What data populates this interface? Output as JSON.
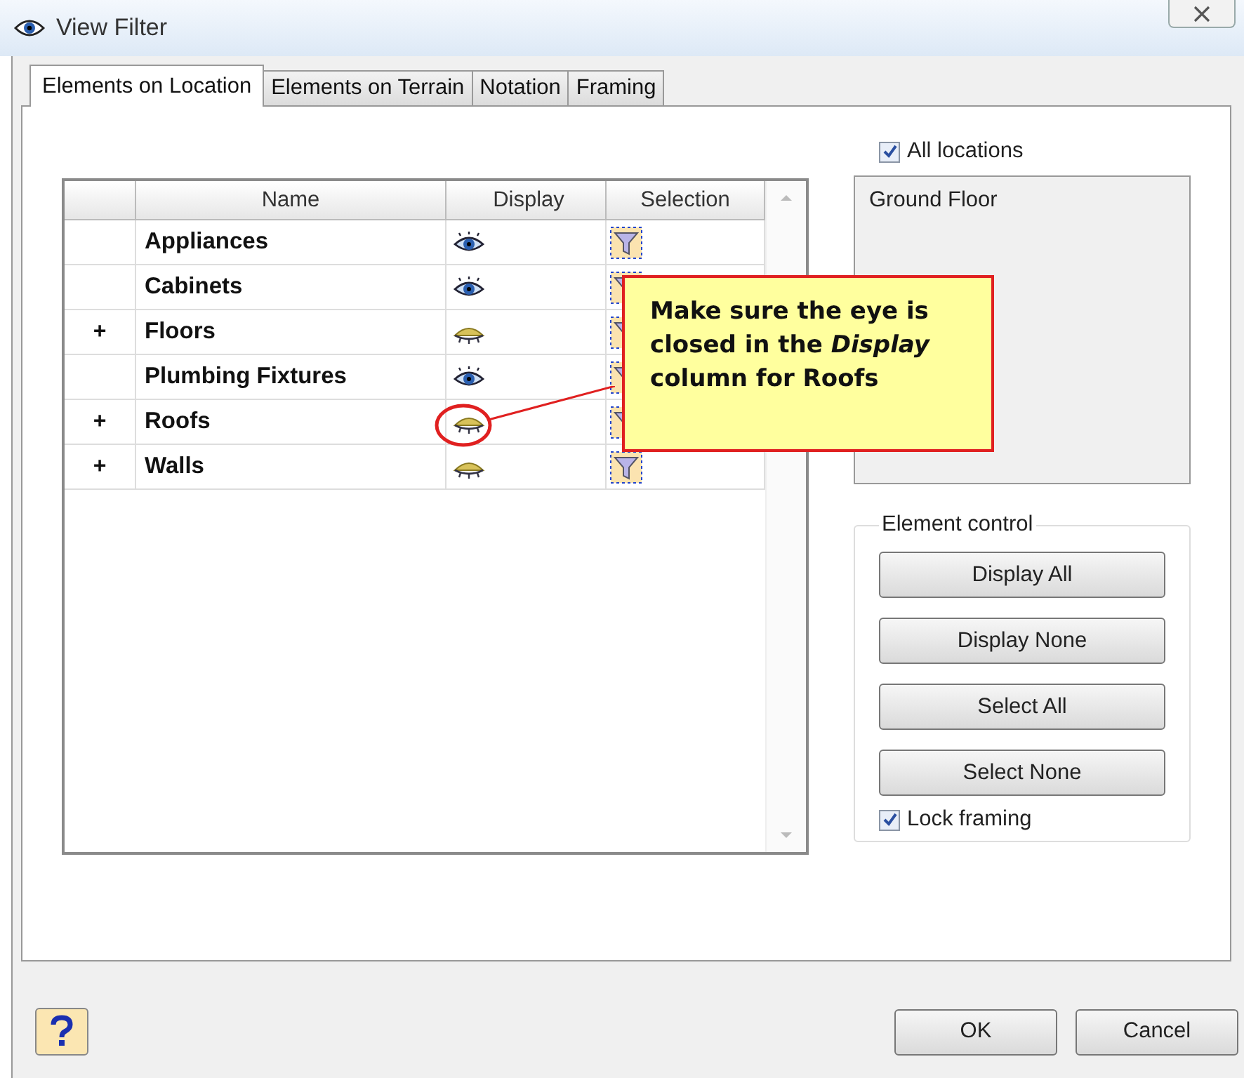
{
  "window": {
    "title": "View Filter"
  },
  "tabs": [
    {
      "label": "Elements on Location",
      "selected": true
    },
    {
      "label": "Elements on Terrain",
      "selected": false
    },
    {
      "label": "Notation",
      "selected": false
    },
    {
      "label": "Framing",
      "selected": false
    }
  ],
  "table": {
    "columns": [
      "Name",
      "Display",
      "Selection"
    ],
    "rows": [
      {
        "expander": "",
        "name": "Appliances",
        "displayed": true,
        "highlighted": false
      },
      {
        "expander": "",
        "name": "Cabinets",
        "displayed": true,
        "highlighted": false
      },
      {
        "expander": "+",
        "name": "Floors",
        "displayed": false,
        "highlighted": false
      },
      {
        "expander": "",
        "name": "Plumbing Fixtures",
        "displayed": true,
        "highlighted": false
      },
      {
        "expander": "+",
        "name": "Roofs",
        "displayed": false,
        "highlighted": true
      },
      {
        "expander": "+",
        "name": "Walls",
        "displayed": false,
        "highlighted": false
      }
    ]
  },
  "locations": {
    "all_label": "All locations",
    "all_checked": true,
    "items": [
      "Ground Floor"
    ]
  },
  "element_control": {
    "title": "Element control",
    "buttons": [
      "Display All",
      "Display None",
      "Select All",
      "Select None"
    ],
    "lock_label": "Lock framing",
    "lock_checked": true
  },
  "callout": {
    "text": "Make sure the eye is closed in the *Display* column for Roofs"
  },
  "buttons": [
    "OK",
    "Cancel"
  ]
}
